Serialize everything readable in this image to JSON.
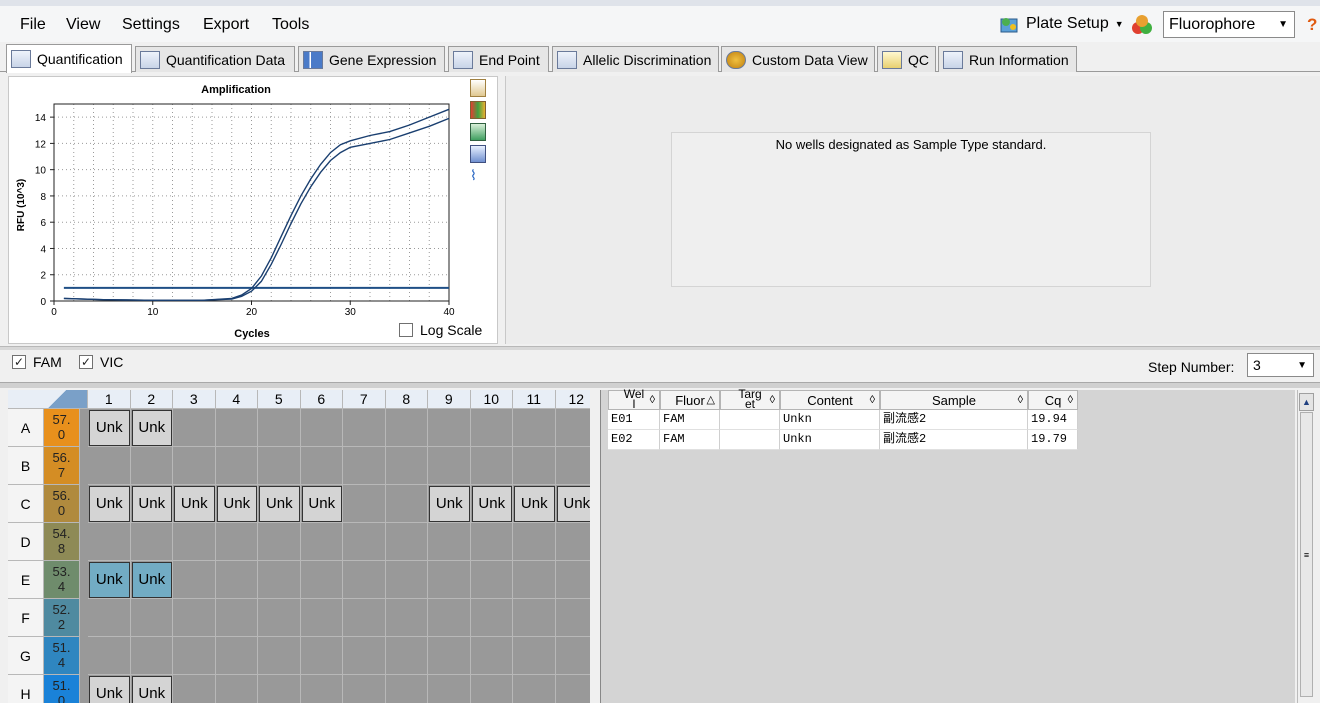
{
  "menu": {
    "items": [
      "File",
      "View",
      "Settings",
      "Export",
      "Tools"
    ]
  },
  "toolbar": {
    "plate_setup": "Plate Setup",
    "fluorophore_select": "Fluorophore",
    "help": "?"
  },
  "tabs": [
    "Quantification",
    "Quantification Data",
    "Gene Expression",
    "End Point",
    "Allelic Discrimination",
    "Custom Data View",
    "QC",
    "Run Information"
  ],
  "chart_data": {
    "type": "line",
    "title": "Amplification",
    "xlabel": "Cycles",
    "ylabel": "RFU (10^3)",
    "xlim": [
      0,
      40
    ],
    "ylim": [
      0,
      15
    ],
    "xticks": [
      "0",
      "10",
      "20",
      "30",
      "40"
    ],
    "yticks": [
      "0",
      "2",
      "4",
      "6",
      "8",
      "10",
      "12",
      "14"
    ],
    "grid": true,
    "threshold": 1.0,
    "series": [
      {
        "x": [
          1,
          5,
          10,
          15,
          18,
          19,
          20,
          21,
          22,
          23,
          24,
          25,
          26,
          27,
          28,
          29,
          30,
          32,
          34,
          36,
          38,
          40
        ],
        "values": [
          0.2,
          0.1,
          0.05,
          0.05,
          0.2,
          0.45,
          0.95,
          1.9,
          3.3,
          4.9,
          6.5,
          8.0,
          9.3,
          10.4,
          11.3,
          11.9,
          12.2,
          12.6,
          12.9,
          13.4,
          14.0,
          14.6
        ]
      },
      {
        "x": [
          1,
          5,
          10,
          15,
          18,
          19,
          20,
          21,
          22,
          23,
          24,
          25,
          26,
          27,
          28,
          29,
          30,
          32,
          34,
          36,
          38,
          40
        ],
        "values": [
          0.2,
          0.1,
          0.05,
          0.05,
          0.15,
          0.35,
          0.75,
          1.5,
          2.8,
          4.3,
          5.9,
          7.4,
          8.7,
          9.8,
          10.7,
          11.3,
          11.7,
          12.0,
          12.3,
          12.8,
          13.3,
          13.9
        ]
      }
    ]
  },
  "log_scale_label": "Log Scale",
  "std_message": "No wells designated as Sample Type standard.",
  "fluors": [
    {
      "label": "FAM",
      "checked": true
    },
    {
      "label": "VIC",
      "checked": true
    }
  ],
  "step": {
    "label": "Step Number:",
    "value": "3"
  },
  "plate": {
    "columns": [
      "1",
      "2",
      "3",
      "4",
      "5",
      "6",
      "7",
      "8",
      "9",
      "10",
      "11",
      "12"
    ],
    "rows": [
      {
        "label": "A",
        "temp": "57.\n0",
        "color": "#e8901c",
        "wells": [
          "Unk",
          "Unk",
          "",
          "",
          "",
          "",
          "",
          "",
          "",
          "",
          "",
          ""
        ],
        "selected": false
      },
      {
        "label": "B",
        "temp": "56.\n7",
        "color": "#d48d24",
        "wells": [
          "",
          "",
          "",
          "",
          "",
          "",
          "",
          "",
          "",
          "",
          "",
          ""
        ],
        "selected": false
      },
      {
        "label": "C",
        "temp": "56.\n0",
        "color": "#b08a3e",
        "wells": [
          "Unk",
          "Unk",
          "Unk",
          "Unk",
          "Unk",
          "Unk",
          "",
          "",
          "Unk",
          "Unk",
          "Unk",
          "Unk"
        ],
        "selected": false
      },
      {
        "label": "D",
        "temp": "54.\n8",
        "color": "#8e8a56",
        "wells": [
          "",
          "",
          "",
          "",
          "",
          "",
          "",
          "",
          "",
          "",
          "",
          ""
        ],
        "selected": false
      },
      {
        "label": "E",
        "temp": "53.\n4",
        "color": "#6f8c6c",
        "wells": [
          "Unk",
          "Unk",
          "",
          "",
          "",
          "",
          "",
          "",
          "",
          "",
          "",
          ""
        ],
        "selected": true
      },
      {
        "label": "F",
        "temp": "52.\n2",
        "color": "#4f8aa0",
        "wells": [
          "",
          "",
          "",
          "",
          "",
          "",
          "",
          "",
          "",
          "",
          "",
          ""
        ],
        "selected": false
      },
      {
        "label": "G",
        "temp": "51.\n4",
        "color": "#2f86c0",
        "wells": [
          "",
          "",
          "",
          "",
          "",
          "",
          "",
          "",
          "",
          "",
          "",
          ""
        ],
        "selected": false
      },
      {
        "label": "H",
        "temp": "51.\n0",
        "color": "#1a82d8",
        "wells": [
          "Unk",
          "Unk",
          "",
          "",
          "",
          "",
          "",
          "",
          "",
          "",
          "",
          ""
        ],
        "selected": false
      }
    ]
  },
  "table": {
    "headers": [
      "Wel\nl",
      "Fluor",
      "Targ\net",
      "Content",
      "Sample",
      "Cq"
    ],
    "rows": [
      [
        "E01",
        "FAM",
        "",
        "Unkn",
        "副流感2",
        "19.94"
      ],
      [
        "E02",
        "FAM",
        "",
        "Unkn",
        "副流感2",
        "19.79"
      ]
    ]
  }
}
